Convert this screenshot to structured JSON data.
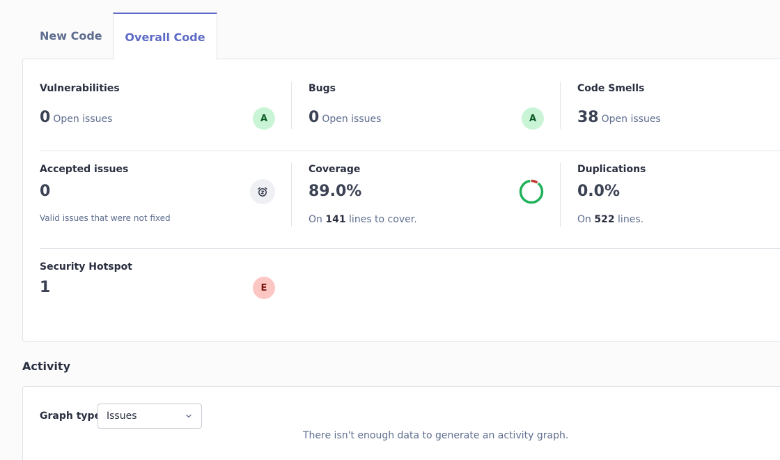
{
  "tabs": [
    {
      "label": "New Code"
    },
    {
      "label": "Overall Code"
    }
  ],
  "measures": {
    "vulnerabilities": {
      "label": "Vulnerabilities",
      "value": "0",
      "subtext": "Open issues",
      "rating": "A"
    },
    "bugs": {
      "label": "Bugs",
      "value": "0",
      "subtext": "Open issues",
      "rating": "A"
    },
    "code_smells": {
      "label": "Code Smells",
      "value": "38",
      "subtext": "Open issues"
    },
    "accepted_issues": {
      "label": "Accepted issues",
      "value": "0",
      "note": "Valid issues that were not fixed"
    },
    "coverage": {
      "label": "Coverage",
      "value": "89.0%",
      "note_prefix": "On",
      "note_count": "141",
      "note_suffix": "lines to cover.",
      "percent": 89.0
    },
    "duplications": {
      "label": "Duplications",
      "value": "0.0%",
      "note_prefix": "On",
      "note_count": "522",
      "note_suffix": "lines."
    },
    "security_hotspot": {
      "label": "Security Hotspot",
      "value": "1",
      "rating": "E"
    }
  },
  "activity": {
    "title": "Activity",
    "graph_type_label": "Graph type",
    "graph_type_selected": "Issues",
    "empty_message": "There isn't enough data to generate an activity graph."
  },
  "colors": {
    "accent": "#5d6bc6",
    "rating_a_bg": "#c9f5d6",
    "rating_e_bg": "#fcc6c3",
    "coverage_green": "#1fb25a",
    "coverage_red": "#c0392b"
  },
  "icons": {
    "accepted": "alarm-clock-icon",
    "select": "chevron-down-icon"
  }
}
